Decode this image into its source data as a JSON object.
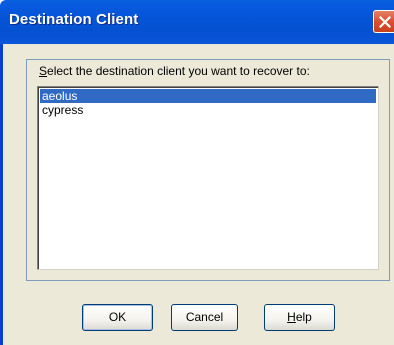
{
  "window": {
    "title": "Destination Client"
  },
  "dialog": {
    "prompt_first_letter": "S",
    "prompt_rest": "elect the destination client you want to recover to:",
    "clients": [
      {
        "label": "aeolus",
        "selected": true
      },
      {
        "label": "cypress",
        "selected": false
      }
    ]
  },
  "buttons": {
    "ok_label": "OK",
    "cancel_label": "Cancel",
    "help_first_letter": "H",
    "help_rest": "elp"
  },
  "icons": {
    "close": "close-icon"
  },
  "colors": {
    "titlebar": "#0554d6",
    "selection": "#316ac5",
    "close_button": "#d9502e",
    "dialog_bg": "#ece9d8"
  }
}
